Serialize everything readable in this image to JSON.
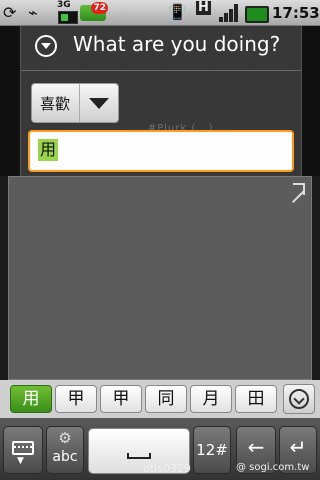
{
  "status_bar": {
    "network": "3G",
    "notification_count": "72",
    "data_type": "H",
    "time": "17:53",
    "icons": [
      "sync-icon",
      "usb-icon",
      "battery-small-icon",
      "notification-badge-icon",
      "vibrate-icon",
      "hspa-icon",
      "signal-icon",
      "battery-icon"
    ]
  },
  "dialog": {
    "title": "What are you doing?",
    "spinner_value": "喜歡",
    "background_hint": "... #Plurk (...) ...",
    "input_text": "用"
  },
  "candidates": {
    "items": [
      "用",
      "甲",
      "甲",
      "同",
      "月",
      "田"
    ],
    "selected_index": 0
  },
  "keyboard": {
    "abc_label": "abc",
    "numbers_label": "12#",
    "backspace_glyph": "←",
    "enter_glyph": "↵"
  },
  "watermark": {
    "user": "otis0329",
    "site": "@ sogi.com.tw"
  },
  "colors": {
    "input_focus_border": "#ff9a1c",
    "selected_candidate": "#4fa624",
    "composing_highlight": "#9ad34c"
  }
}
